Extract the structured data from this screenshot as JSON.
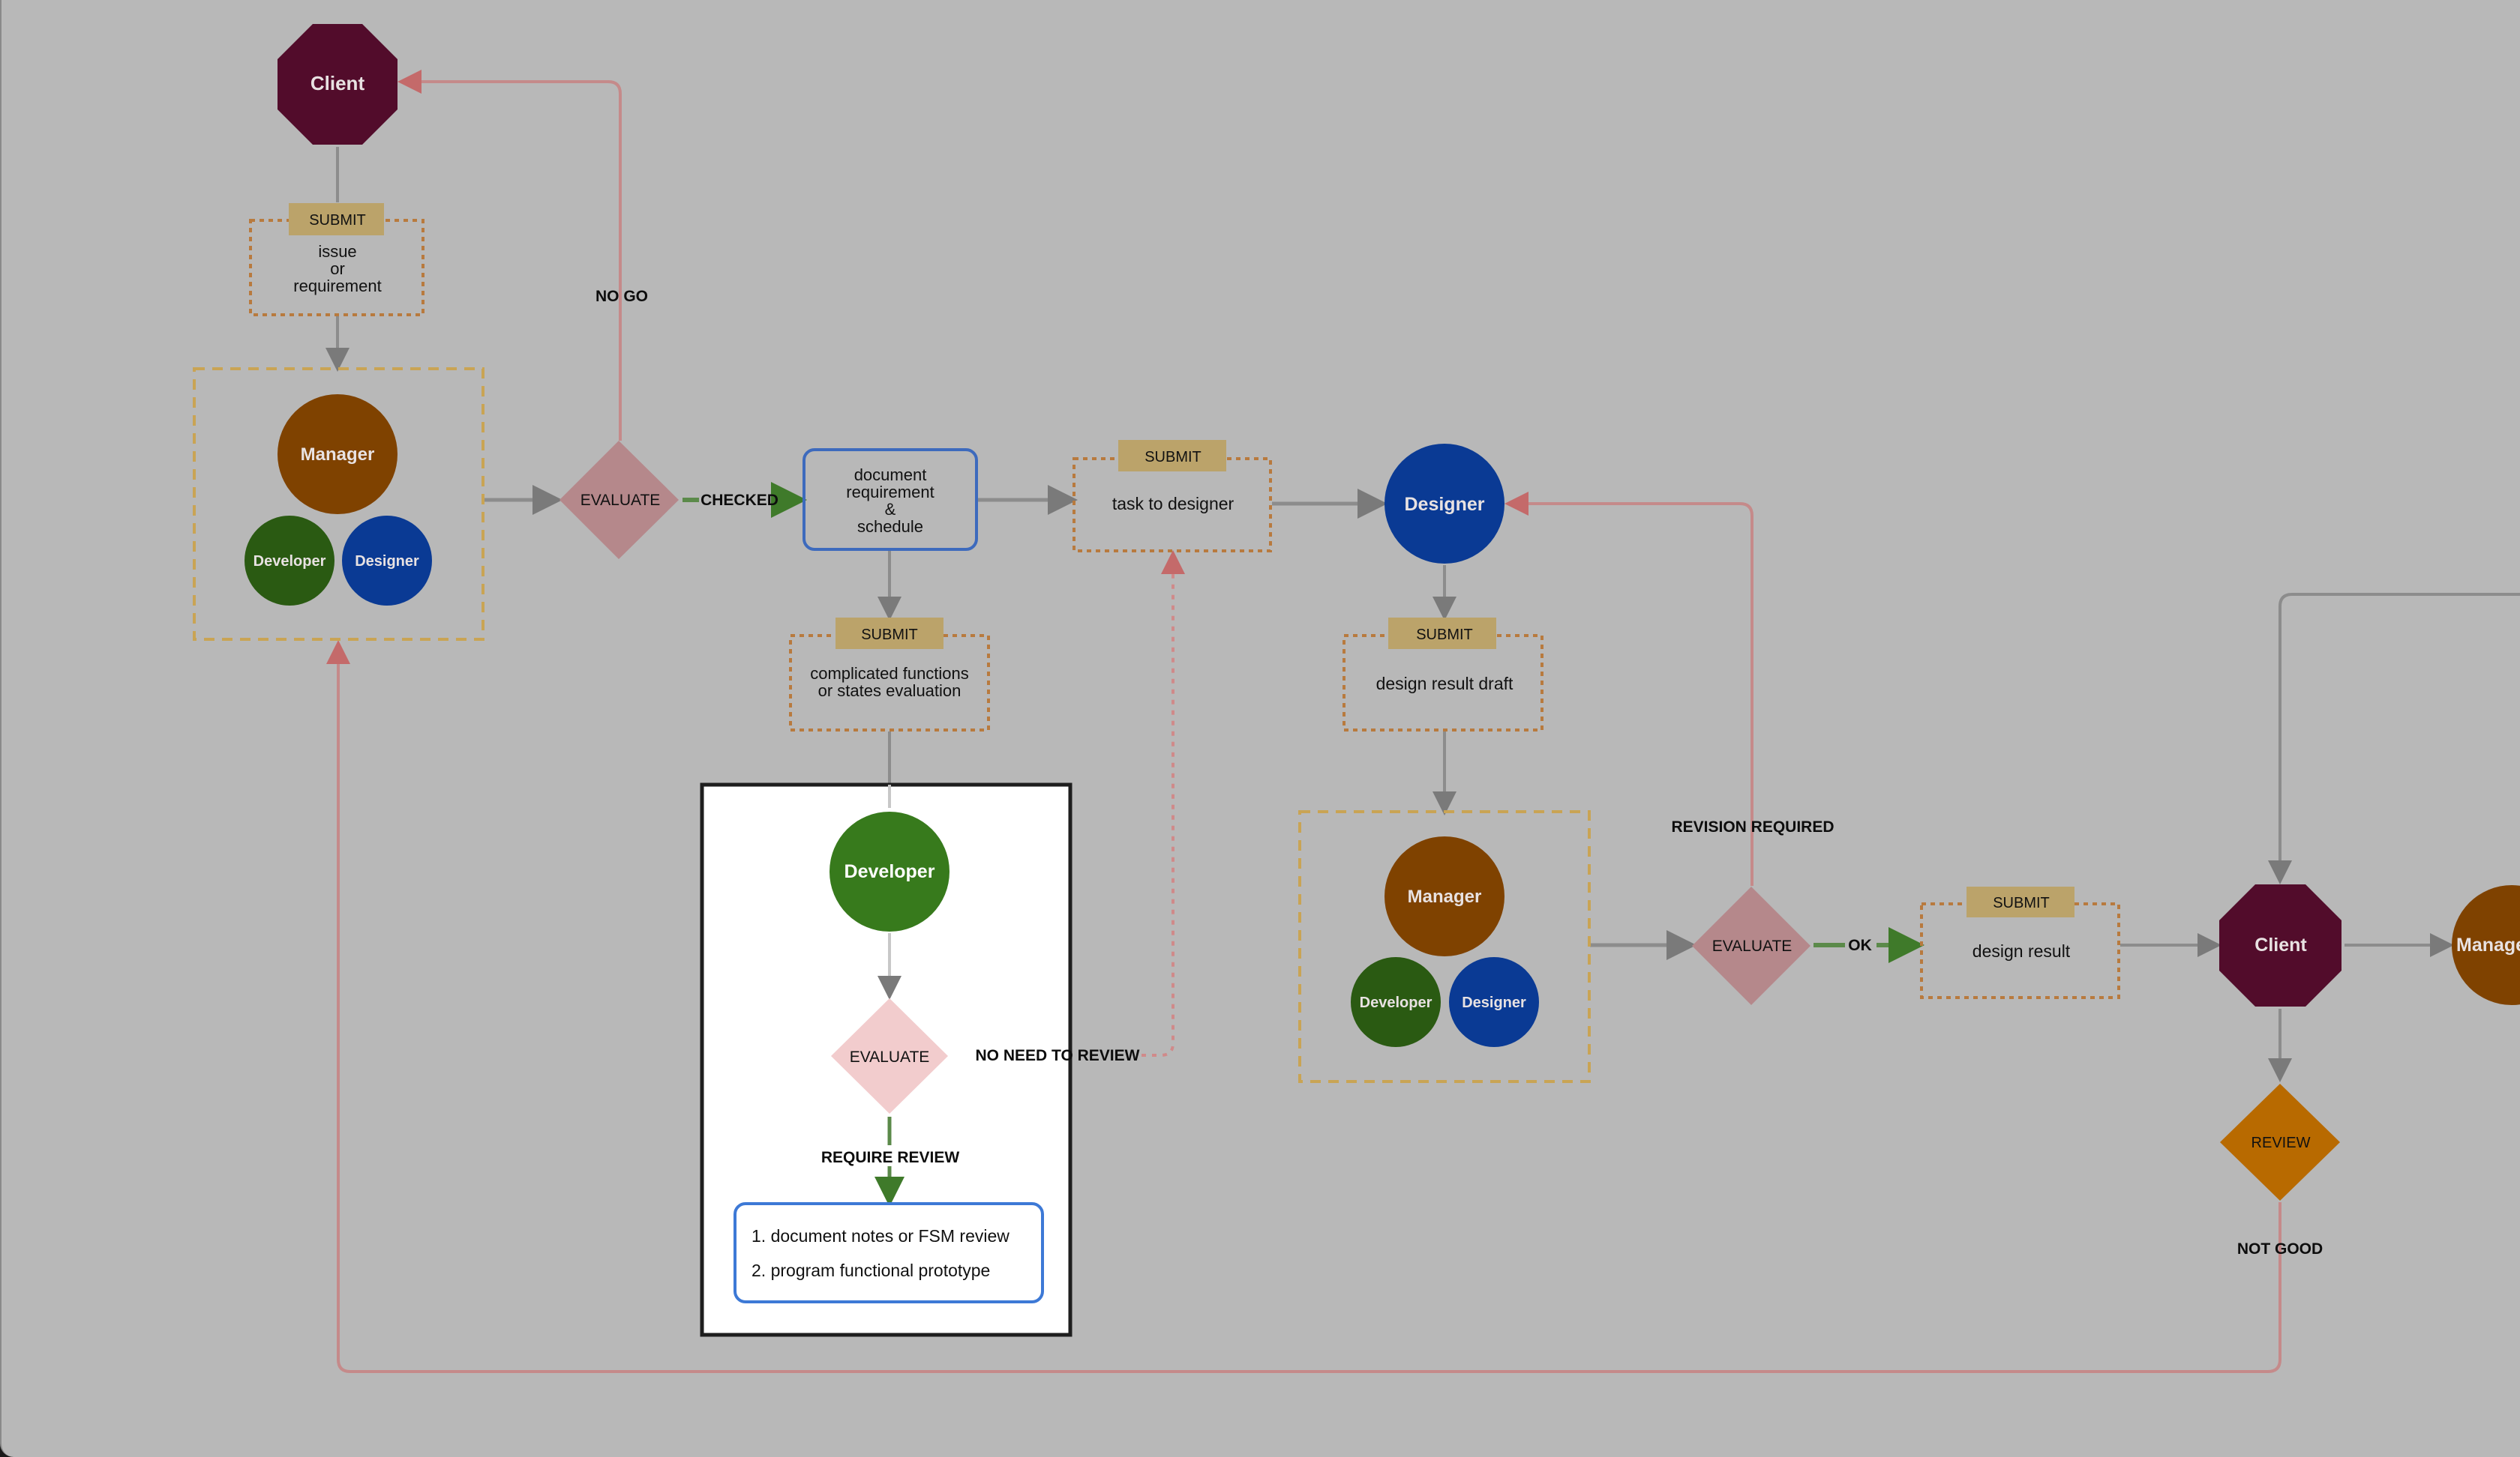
{
  "diagram": {
    "colors": {
      "background": "#b8b8b8",
      "client": "#520c2b",
      "manager": "#7f4200",
      "developer": "#2a5a12",
      "developer_bright": "#377a1c",
      "designer": "#0a3a94",
      "evaluate_fill": "#b5888b",
      "evaluate_highlight_fill": "#f2cccd",
      "review_fill": "#b86a00",
      "submit_tag": "#bba36a",
      "submit_border": "#b87a3e",
      "group_border": "#c9a454",
      "doc_border": "#3d6abd",
      "list_border": "#3d79d6",
      "edge_gray": "#8c8c8c",
      "edge_red": "#c58a8a",
      "edge_green": "#5b8a4a",
      "panel_bg": "#ffffff",
      "panel_border": "#1e1e1e"
    },
    "nodes": {
      "client_top": "Client",
      "submit_issue_tag": "SUBMIT",
      "submit_issue_lines": [
        "issue",
        "or",
        "requirement"
      ],
      "team1_manager": "Manager",
      "team1_developer": "Developer",
      "team1_designer": "Designer",
      "evaluate1": "EVALUATE",
      "doc_lines": [
        "document",
        "requirement",
        "&",
        "schedule"
      ],
      "submit_task_tag": "SUBMIT",
      "submit_task_text": "task to designer",
      "designer": "Designer",
      "submit_complicated_tag": "SUBMIT",
      "submit_complicated_lines": [
        "complicated functions",
        "or states evaluation"
      ],
      "developer": "Developer",
      "evaluate2": "EVALUATE",
      "review_list": [
        "1. document notes or FSM review",
        "2. program functional prototype"
      ],
      "submit_draft_tag": "SUBMIT",
      "submit_draft_text": "design result draft",
      "team2_manager": "Manager",
      "team2_developer": "Developer",
      "team2_designer": "Designer",
      "evaluate3": "EVALUATE",
      "submit_result_tag": "SUBMIT",
      "submit_result_text": "design result",
      "client_right": "Client",
      "manager_right": "Manager",
      "review": "REVIEW"
    },
    "edge_labels": {
      "no_go": "NO GO",
      "checked": "CHECKED",
      "no_need_to_review": "NO NEED TO REVIEW",
      "require_review": "REQUIRE REVIEW",
      "revision_required": "REVISION REQUIRED",
      "ok": "OK",
      "not_good": "NOT GOOD"
    }
  }
}
